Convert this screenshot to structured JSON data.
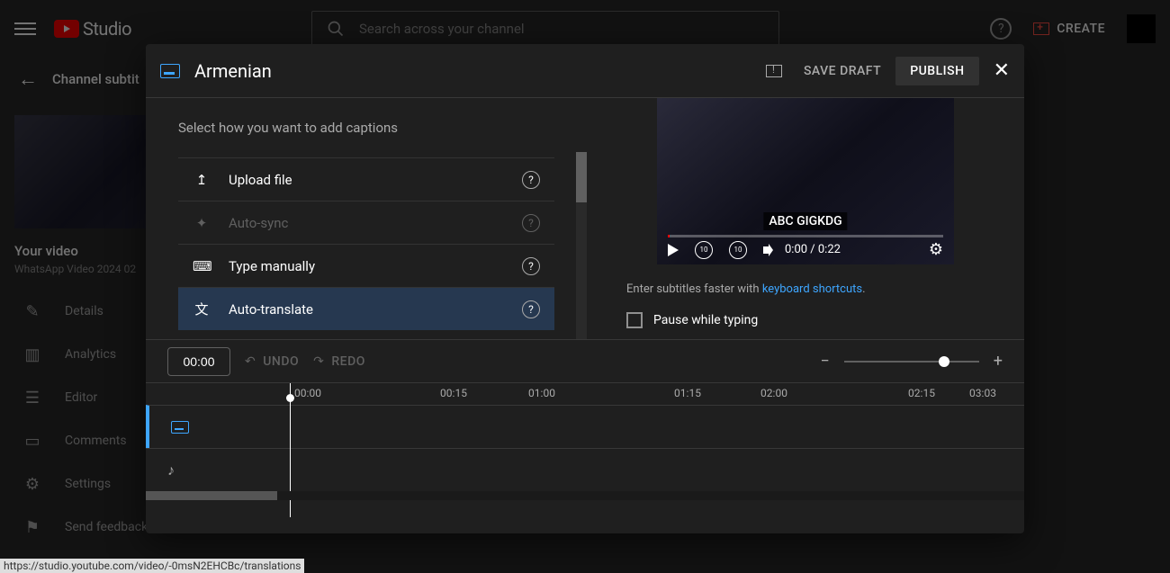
{
  "header": {
    "logo_text": "Studio",
    "search_placeholder": "Search across your channel",
    "create_label": "CREATE"
  },
  "subheader": {
    "title": "Channel subtit"
  },
  "sidebar": {
    "your_video_label": "Your video",
    "video_title": "WhatsApp Video 2024 02",
    "nav": [
      {
        "label": "Details"
      },
      {
        "label": "Analytics"
      },
      {
        "label": "Editor"
      },
      {
        "label": "Comments"
      },
      {
        "label": "Settings"
      },
      {
        "label": "Send feedback"
      }
    ]
  },
  "modal": {
    "title": "Armenian",
    "save_draft": "SAVE DRAFT",
    "publish": "PUBLISH",
    "intro": "Select how you want to add captions",
    "options": {
      "upload": "Upload file",
      "autosync": "Auto-sync",
      "manual": "Type manually",
      "autotrans": "Auto-translate"
    },
    "caption_text": "ABC GIGKDG",
    "time_display": "0:00 / 0:22",
    "kb_hint_pre": "Enter subtitles faster with ",
    "kb_hint_link": "keyboard shortcuts",
    "pause_label": "Pause while typing",
    "time_input": "00:00",
    "undo": "UNDO",
    "redo": "REDO",
    "ruler": [
      "00:00",
      "00:15",
      "01:00",
      "01:15",
      "02:00",
      "02:15",
      "03:03"
    ]
  },
  "status_url": "https://studio.youtube.com/video/-0msN2EHCBc/translations",
  "chart_data": null
}
